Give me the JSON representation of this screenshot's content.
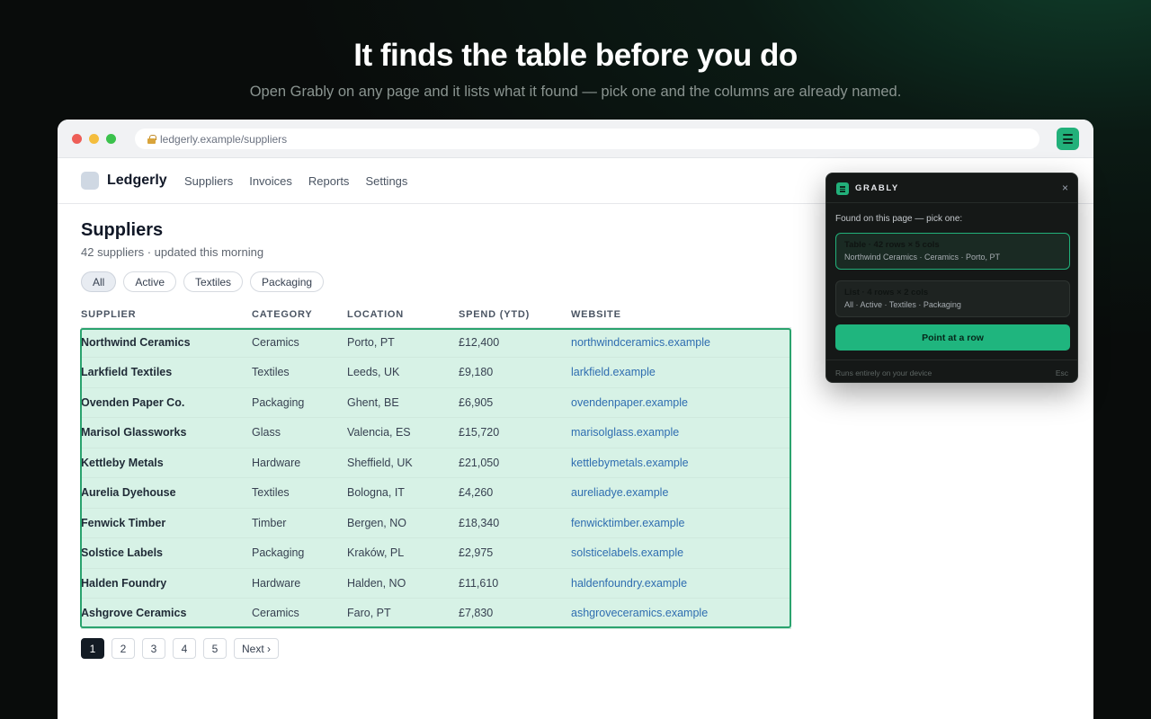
{
  "hero": {
    "title": "It finds the table before you do",
    "subtitle": "Open Grably on any page and it lists what it found — pick one and the columns are already named."
  },
  "browser": {
    "url": "ledgerly.example/suppliers",
    "extension_icon": "grably-icon"
  },
  "app": {
    "brand": "Ledgerly",
    "nav": [
      "Suppliers",
      "Invoices",
      "Reports",
      "Settings"
    ]
  },
  "page": {
    "title": "Suppliers",
    "subtitle": "42 suppliers · updated this morning",
    "filters": [
      {
        "label": "All",
        "active": true
      },
      {
        "label": "Active",
        "active": false
      },
      {
        "label": "Textiles",
        "active": false
      },
      {
        "label": "Packaging",
        "active": false
      }
    ]
  },
  "table": {
    "headers": [
      "SUPPLIER",
      "CATEGORY",
      "LOCATION",
      "SPEND (YTD)",
      "WEBSITE"
    ],
    "rows": [
      [
        "Northwind Ceramics",
        "Ceramics",
        "Porto, PT",
        "£12,400",
        "northwindceramics.example"
      ],
      [
        "Larkfield Textiles",
        "Textiles",
        "Leeds, UK",
        "£9,180",
        "larkfield.example"
      ],
      [
        "Ovenden Paper Co.",
        "Packaging",
        "Ghent, BE",
        "£6,905",
        "ovendenpaper.example"
      ],
      [
        "Marisol Glassworks",
        "Glass",
        "Valencia, ES",
        "£15,720",
        "marisolglass.example"
      ],
      [
        "Kettleby Metals",
        "Hardware",
        "Sheffield, UK",
        "£21,050",
        "kettlebymetals.example"
      ],
      [
        "Aurelia Dyehouse",
        "Textiles",
        "Bologna, IT",
        "£4,260",
        "aureliadye.example"
      ],
      [
        "Fenwick Timber",
        "Timber",
        "Bergen, NO",
        "£18,340",
        "fenwicktimber.example"
      ],
      [
        "Solstice Labels",
        "Packaging",
        "Kraków, PL",
        "£2,975",
        "solsticelabels.example"
      ],
      [
        "Halden Foundry",
        "Hardware",
        "Halden, NO",
        "£11,610",
        "haldenfoundry.example"
      ],
      [
        "Ashgrove Ceramics",
        "Ceramics",
        "Faro, PT",
        "£7,830",
        "ashgroveceramics.example"
      ]
    ]
  },
  "pagination": {
    "pages": [
      "1",
      "2",
      "3",
      "4",
      "5"
    ],
    "current": "1",
    "next_label": "Next ›"
  },
  "popup": {
    "title": "GRABLY",
    "close": "×",
    "prompt": "Found on this page — pick one:",
    "options": [
      {
        "title": "Table · 42 rows × 5 cols",
        "detail": "Northwind Ceramics · Ceramics · Porto, PT"
      },
      {
        "title": "List · 4 rows × 2 cols",
        "detail": "All · Active · Textiles · Packaging"
      }
    ],
    "action": "Point at a row",
    "footer_left": "Runs entirely on your device",
    "footer_right": "Esc"
  },
  "colors": {
    "accent": "#22b07a",
    "selection_fill": "#d7f2e6",
    "link": "#2f6db0"
  }
}
